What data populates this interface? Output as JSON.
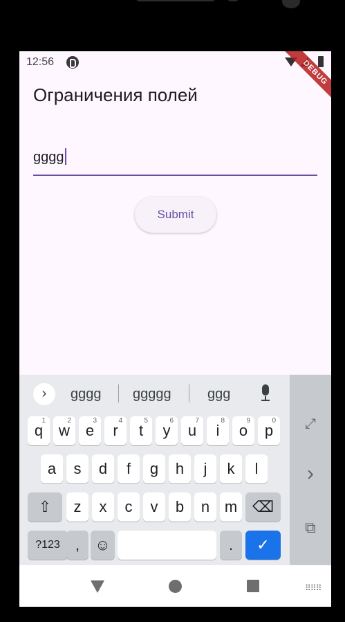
{
  "status_bar": {
    "time": "12:56"
  },
  "debug_banner": "DEBUG",
  "app": {
    "title": "Ограничения полей",
    "field_value": "gggg",
    "submit_label": "Submit"
  },
  "keyboard": {
    "suggestions": [
      "gggg",
      "ggggg",
      "ggg"
    ],
    "row1": [
      {
        "k": "q",
        "n": "1"
      },
      {
        "k": "w",
        "n": "2"
      },
      {
        "k": "e",
        "n": "3"
      },
      {
        "k": "r",
        "n": "4"
      },
      {
        "k": "t",
        "n": "5"
      },
      {
        "k": "y",
        "n": "6"
      },
      {
        "k": "u",
        "n": "7"
      },
      {
        "k": "i",
        "n": "8"
      },
      {
        "k": "o",
        "n": "9"
      },
      {
        "k": "p",
        "n": "0"
      }
    ],
    "row2": [
      "a",
      "s",
      "d",
      "f",
      "g",
      "h",
      "j",
      "k",
      "l"
    ],
    "row3": [
      "z",
      "x",
      "c",
      "v",
      "b",
      "n",
      "m"
    ],
    "symbols_label": "?123",
    "comma_label": ",",
    "period_label": ".",
    "emoji_glyph": "☺",
    "shift_glyph": "⇧",
    "backspace_glyph": "⌫",
    "done_glyph": "✓",
    "chevron_glyph": "›",
    "side_expand_glyph": "⤢",
    "side_arrow_glyph": "›",
    "side_float_glyph": "⧉"
  },
  "nav": {
    "keyboard_glyph": "⠿⠿⠿"
  },
  "colors": {
    "accent": "#6750a4",
    "background": "#fef7ff",
    "keyboard_bg": "#e8eaed",
    "done_key": "#1a73e8"
  }
}
